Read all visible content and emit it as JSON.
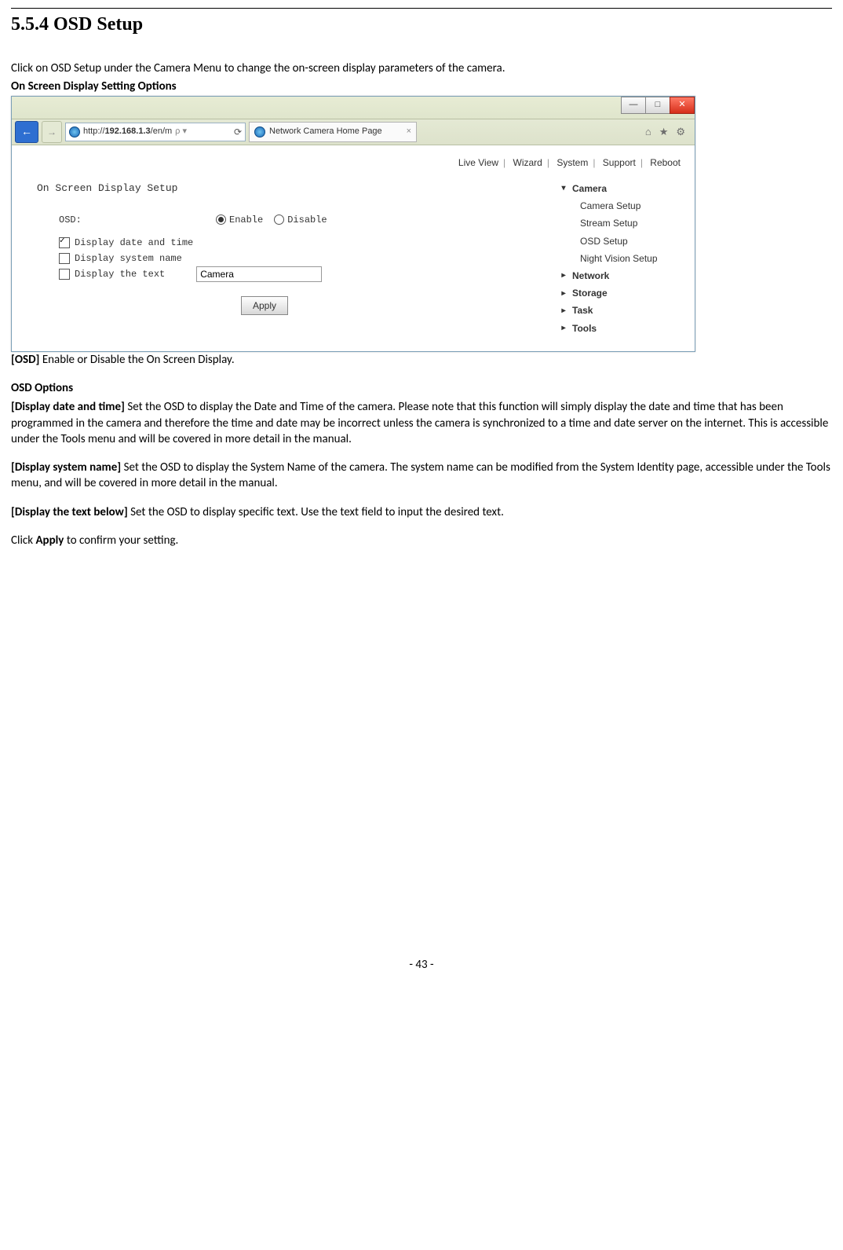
{
  "heading": "5.5.4    OSD Setup",
  "intro": "Click on OSD Setup under the Camera Menu to change the on-screen display parameters of the camera.",
  "sub_opts_title": "On Screen Display Setting Options",
  "browser": {
    "url_prefix": "http://",
    "url_ip": "192.168.1.3",
    "url_suffix": "/en/m",
    "refresh_glyph": "⟳",
    "tab_title": "Network Camera Home Page",
    "tab_close_glyph": "×",
    "icons": {
      "home": "⌂",
      "star": "★",
      "gear": "⚙"
    },
    "win_btns": {
      "min": "—",
      "max": "□",
      "close": "✕"
    },
    "back_glyph": "←",
    "fwd_glyph": "→"
  },
  "topnav": {
    "items": [
      "Live View",
      "Wizard",
      "System",
      "Support",
      "Reboot"
    ]
  },
  "form": {
    "panel_title": "On Screen Display Setup",
    "osd_label": "OSD:",
    "enable_label": "Enable",
    "disable_label": "Disable",
    "chk_date": "Display date and time",
    "chk_sys": "Display system name",
    "chk_text": "Display the text",
    "text_value": "Camera",
    "apply_label": "Apply"
  },
  "sidenav": {
    "camera": "Camera",
    "camera_items": [
      "Camera Setup",
      "Stream Setup",
      "OSD Setup",
      "Night Vision Setup"
    ],
    "others": [
      "Network",
      "Storage",
      "Task",
      "Tools"
    ]
  },
  "desc_osd_label": "[OSD] ",
  "desc_osd_text": "Enable or Disable the On Screen Display.",
  "osd_options_heading": "OSD Options",
  "desc_date_label": "[Display date and time] ",
  "desc_date_text": "Set the OSD to display the Date and Time of the camera. Please note that this function will simply display the date and time that has been programmed in the camera and therefore the time and date may be incorrect unless the camera is synchronized to a time and date server on the internet. This is accessible under the Tools menu and will be covered in more detail in the manual.",
  "desc_sys_label": "[Display system name] ",
  "desc_sys_text": "Set the OSD to display the System Name of the camera. The system name can be modified from the System Identity page, accessible under the Tools menu, and will be covered in more detail in the manual.",
  "desc_text_label": "[Display the text below] ",
  "desc_text_text": "Set the OSD to display specific text. Use the text field to input the desired text.",
  "final_prefix": "Click ",
  "final_bold": "Apply",
  "final_suffix": " to confirm your setting.",
  "page_number": "- 43 -"
}
